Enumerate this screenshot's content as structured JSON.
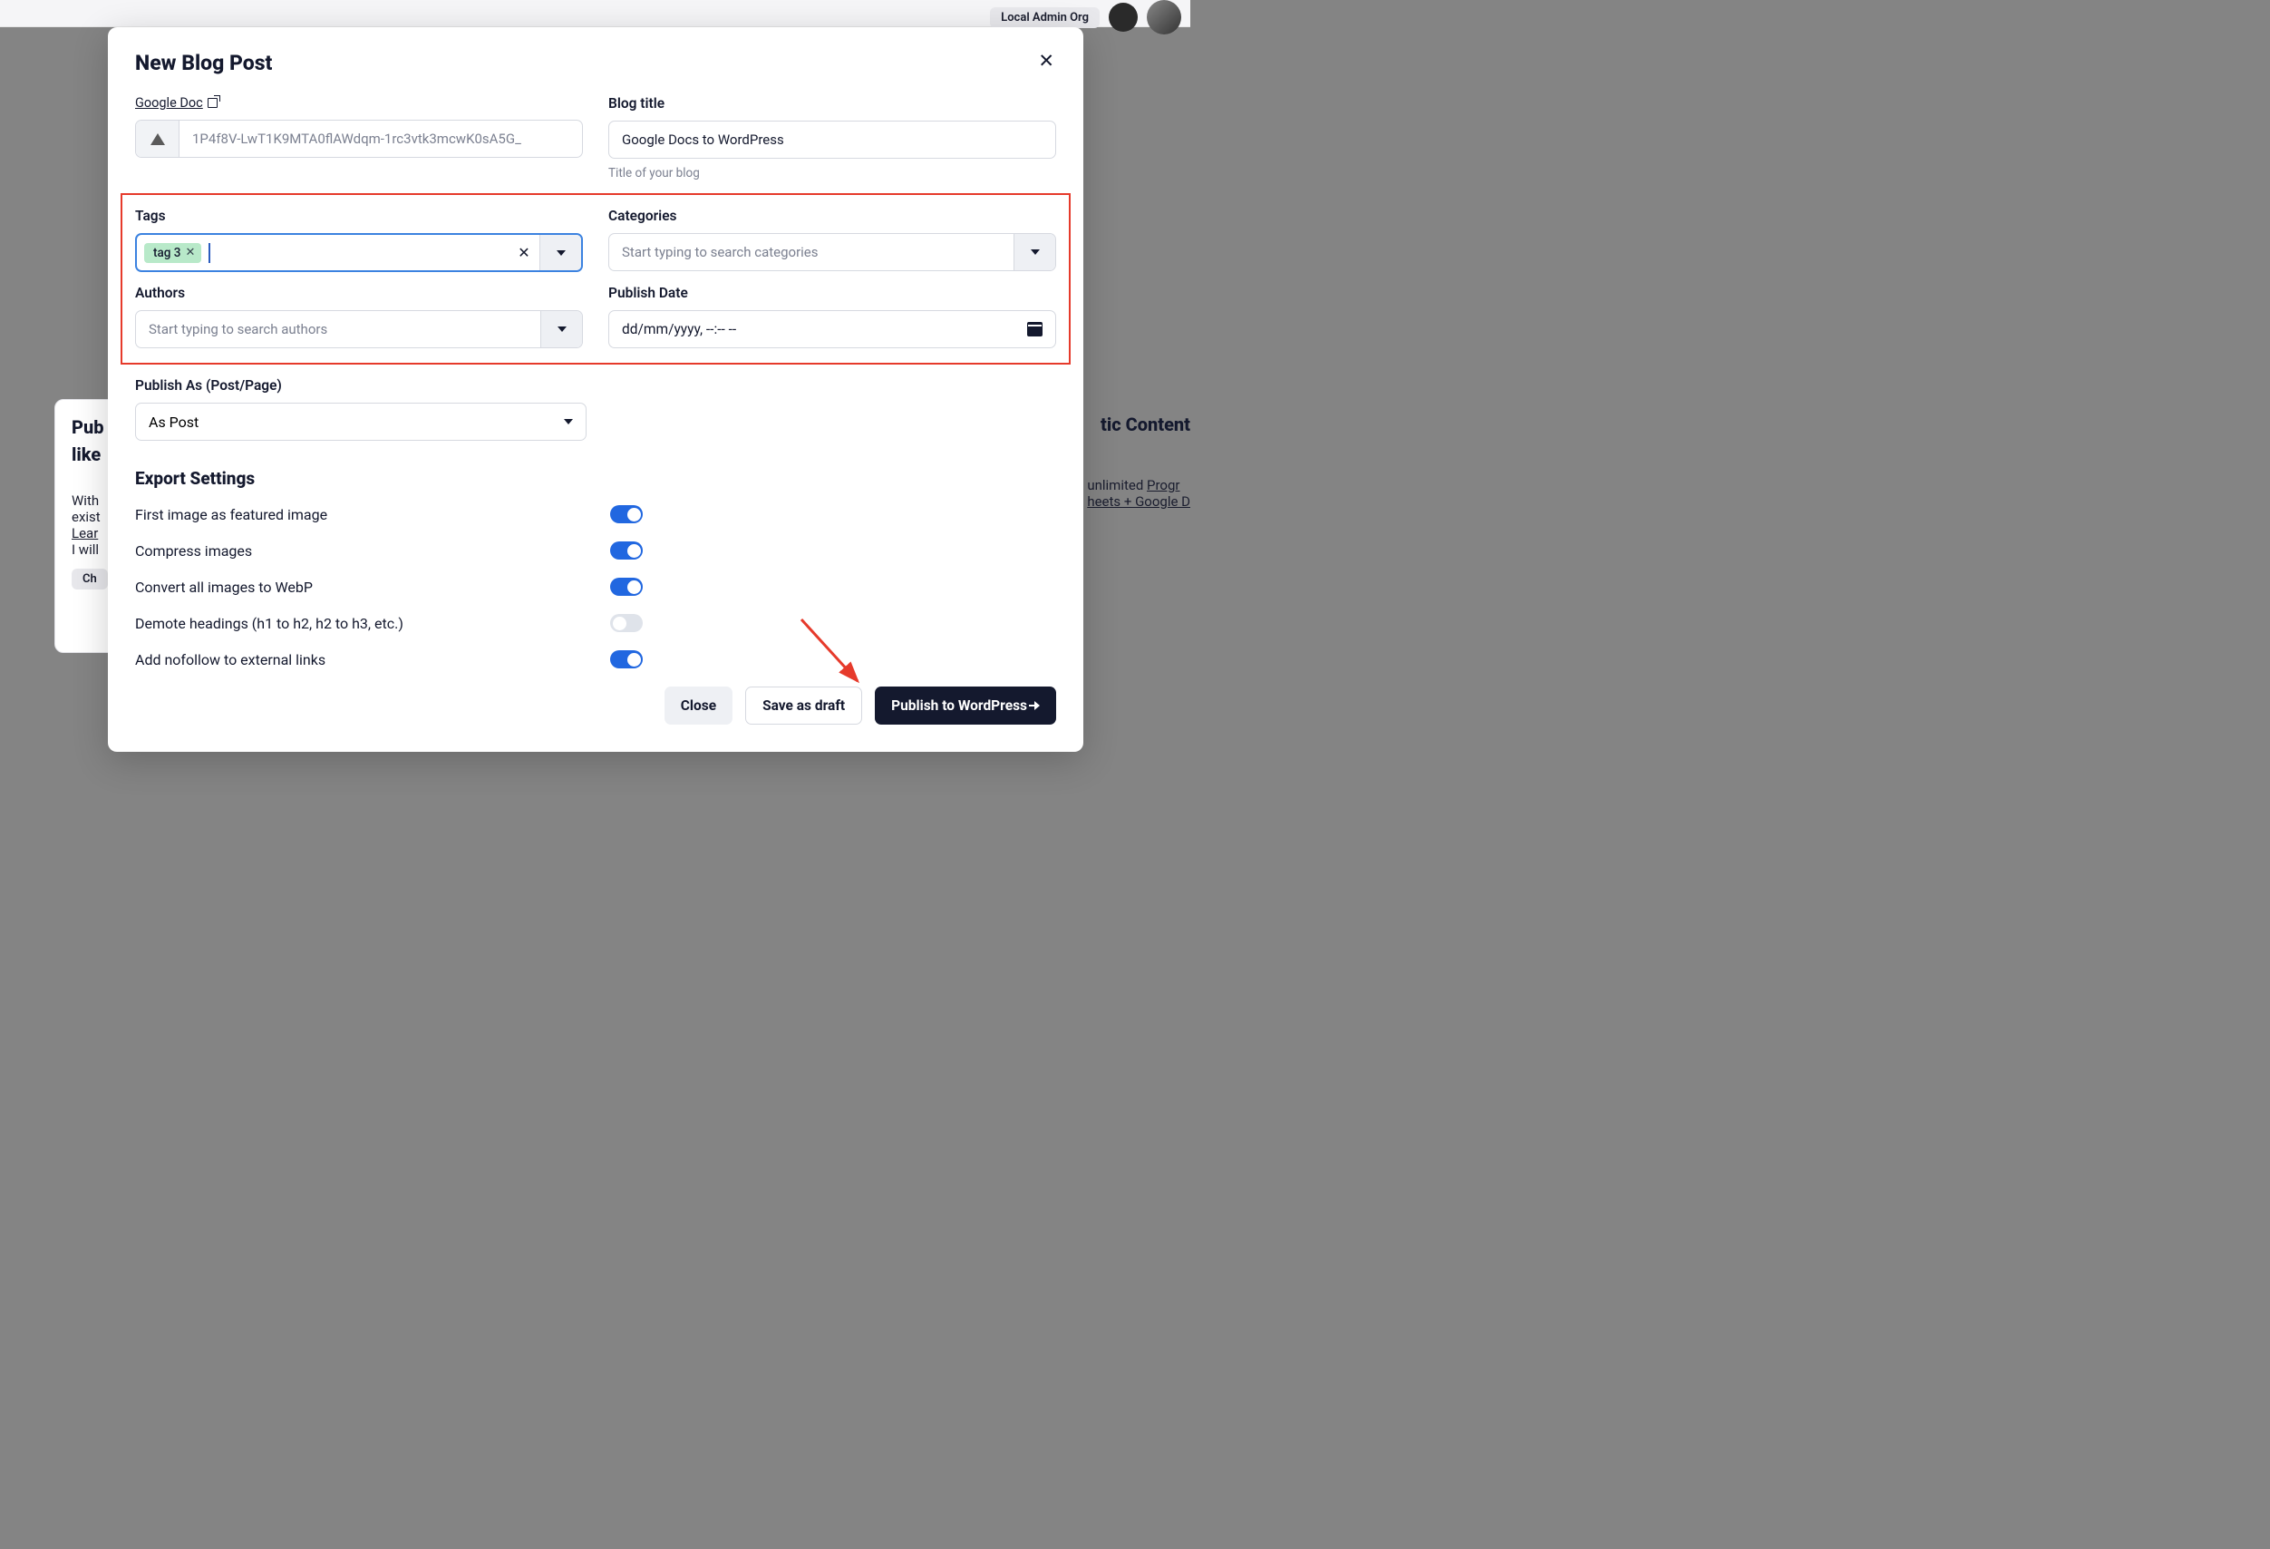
{
  "bg": {
    "org_label": "Local Admin Org",
    "left_title1": "Pub",
    "left_title2": "like",
    "left_body1": "With",
    "left_body2": "exist",
    "left_link": "Lear",
    "left_body3": "I will",
    "left_button": "Ch",
    "right_title": "tic Content",
    "right_line1": "unlimited",
    "right_link1": "Progr",
    "right_link2": "heets + Google D"
  },
  "modal": {
    "title": "New Blog Post",
    "google_doc_label": "Google Doc",
    "google_doc_value": "1P4f8V-LwT1K9MTA0flAWdqm-1rc3vtk3mcwK0sA5G_",
    "blog_title_label": "Blog title",
    "blog_title_value": "Google Docs to WordPress",
    "blog_title_help": "Title of your blog",
    "tags_label": "Tags",
    "tags_chip": "tag 3",
    "categories_label": "Categories",
    "categories_placeholder": "Start typing to search categories",
    "authors_label": "Authors",
    "authors_placeholder": "Start typing to search authors",
    "publish_date_label": "Publish Date",
    "publish_date_value": "dd/mm/yyyy, --:-- --",
    "publish_as_label": "Publish As (Post/Page)",
    "publish_as_value": "As Post",
    "export_settings": "Export Settings",
    "toggle1": "First image as featured image",
    "toggle2": "Compress images",
    "toggle3": "Convert all images to WebP",
    "toggle4": "Demote headings (h1 to h2, h2 to h3, etc.)",
    "toggle5": "Add nofollow to external links",
    "btn_close": "Close",
    "btn_draft": "Save as draft",
    "btn_publish": "Publish to WordPress"
  }
}
